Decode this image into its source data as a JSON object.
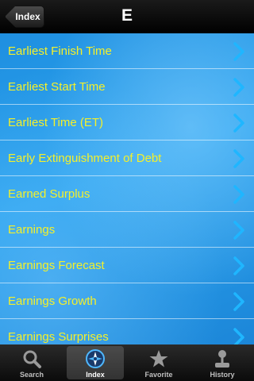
{
  "header": {
    "back_label": "Index",
    "title": "E"
  },
  "list": {
    "items": [
      {
        "label": "Earliest Finish Time"
      },
      {
        "label": "Earliest Start Time"
      },
      {
        "label": "Earliest Time (ET)"
      },
      {
        "label": "Early Extinguishment of Debt"
      },
      {
        "label": "Earned Surplus"
      },
      {
        "label": "Earnings"
      },
      {
        "label": "Earnings Forecast"
      },
      {
        "label": "Earnings Growth"
      },
      {
        "label": "Earnings Surprises"
      }
    ]
  },
  "tabbar": {
    "tabs": [
      {
        "label": "Search",
        "icon": "search-icon"
      },
      {
        "label": "Index",
        "icon": "compass-icon",
        "active": true
      },
      {
        "label": "Favorite",
        "icon": "star-icon"
      },
      {
        "label": "History",
        "icon": "joystick-icon"
      }
    ]
  },
  "colors": {
    "item_text": "#f4f02a",
    "chevron": "#1fb6ff",
    "list_background": "#2aa3ef"
  }
}
